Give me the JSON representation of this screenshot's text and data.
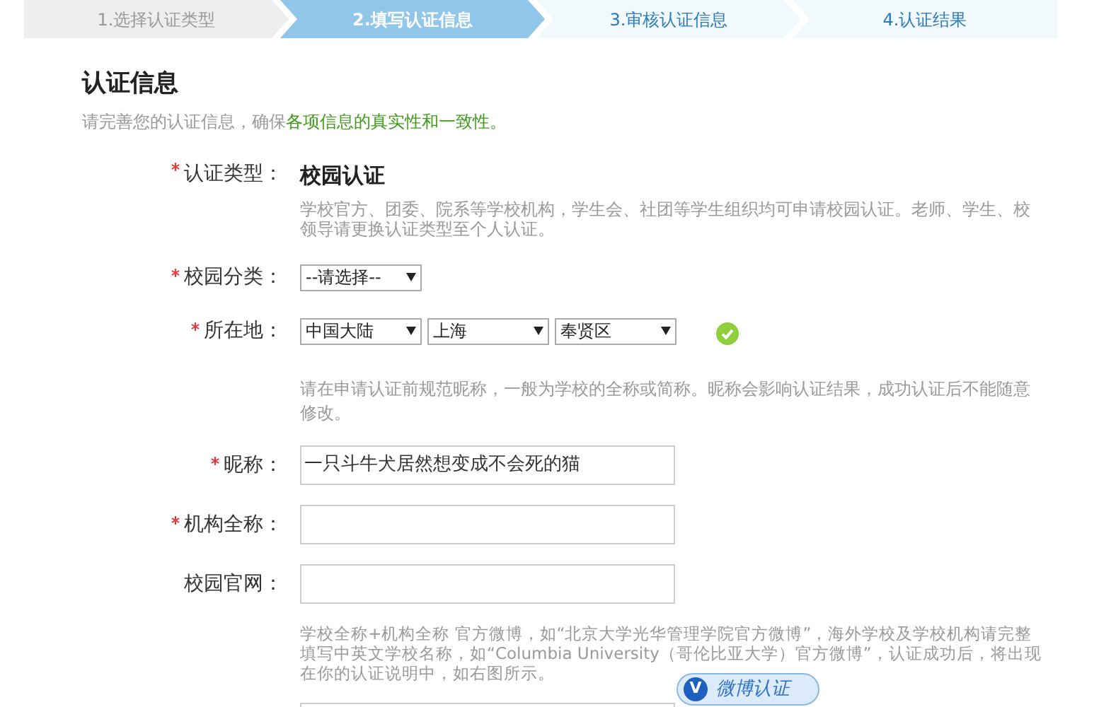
{
  "steps": [
    {
      "label": "1.选择认证类型",
      "selected": false,
      "done": true
    },
    {
      "label": "2.填写认证信息",
      "selected": true
    },
    {
      "label": "3.审核认证信息",
      "selected": false,
      "done": false
    },
    {
      "label": "4.认证结果",
      "selected": false,
      "done": false
    }
  ],
  "section": {
    "title": "认证信息",
    "subtitle": "请完善您的认证信息，确保",
    "subtitle_highlight": "各项信息的真实性和一致性。"
  },
  "rows": [
    {
      "kind": "static",
      "label": "认证类型：",
      "required": true,
      "value": "校园认证",
      "note": "学校官方、团委、院系等学校机构，学生会、社团等学生组织均可申请校园认证。老师、学生、校领导请更换认证类型至个人认证。"
    },
    {
      "kind": "select",
      "label": "校园分类：",
      "required": true,
      "selects": [
        {
          "value": "--请选择--"
        }
      ],
      "valid": false
    },
    {
      "kind": "select",
      "label": "所在地：",
      "required": true,
      "selects": [
        {
          "value": "中国大陆"
        },
        {
          "value": "上海"
        },
        {
          "value": "奉贤区"
        }
      ],
      "valid": true
    },
    {
      "kind": "note",
      "text": "请在申请认证前规范昵称，一般为学校的全称或简称。昵称会影响认证结果，成功认证后不能随意修改。"
    },
    {
      "kind": "text",
      "label": "昵称：",
      "required": true,
      "value": "一只斗牛犬居然想变成不会死的猫"
    },
    {
      "kind": "text",
      "label": "机构全称：",
      "required": true
    },
    {
      "kind": "text",
      "label": "校园官网：",
      "required": false
    },
    {
      "kind": "note",
      "text": "学校全称+机构全称 官方微博，如“北京大学光华管理学院官方微博”，海外学校及学校机构请完整填写中英文学校名称，如“Columbia University（哥伦比亚大学）官方微博”，认证成功后，将出现在你的认证说明中，如右图所示。"
    },
    {
      "kind": "text"
    }
  ],
  "badge": {
    "icon_text": "V",
    "text": "微博认证"
  }
}
